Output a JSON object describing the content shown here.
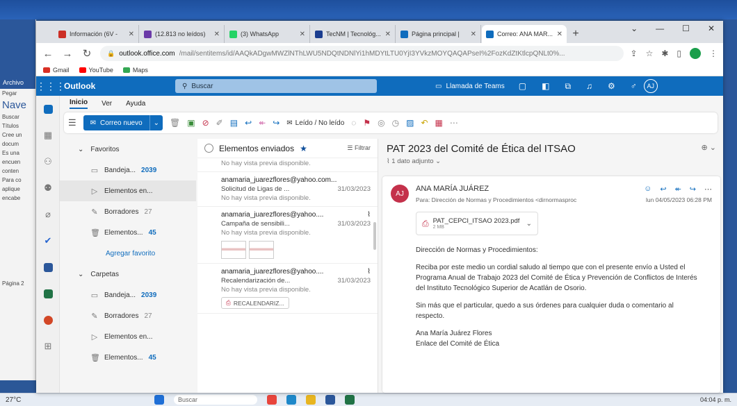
{
  "word": {
    "archivo": "Archivo",
    "pegar": "Pegar",
    "nav": "Nave",
    "buscar": "Buscar",
    "titulos": "Títulos",
    "lines": [
      "Cree un",
      "docum",
      "Es una",
      "encuen",
      "conten",
      "Para co",
      "aplique",
      "encabe"
    ],
    "pagina": "Página 2"
  },
  "taskbar": {
    "temp": "27°C",
    "search": "Buscar",
    "time": "04:04 p. m."
  },
  "browser": {
    "tabs": [
      {
        "title": "Información (6V - ",
        "color": "#cc2f26"
      },
      {
        "title": "(12.813 no leídos) ",
        "color": "#6b3aa8"
      },
      {
        "title": "(3) WhatsApp",
        "color": "#25d366"
      },
      {
        "title": "TecNM | Tecnológ...",
        "color": "#1b3d8f"
      },
      {
        "title": "Página principal | ",
        "color": "#0f6cbd"
      },
      {
        "title": "Correo: ANA MAR...",
        "color": "#0f6cbd"
      }
    ],
    "url_host": "outlook.office.com",
    "url_path": "/mail/sentitems/id/AAQkADgwMWZlNThLWU5NDQtNDNlYi1hMDYtLTU0YjI3YVkzMOYQAQAPseI%2FozKdZtKtlcpQNLt0%...",
    "bookmarks": [
      {
        "label": "Gmail",
        "color": "#d93025"
      },
      {
        "label": "YouTube",
        "color": "#ff0000"
      },
      {
        "label": "Maps",
        "color": "#34a853"
      }
    ]
  },
  "outlook": {
    "brand": "Outlook",
    "search_placeholder": "Buscar",
    "teams_call": "Llamada de Teams",
    "avatar": "AJ",
    "ribbon_tabs": [
      "Inicio",
      "Ver",
      "Ayuda"
    ],
    "new_mail": "Correo nuevo",
    "read_unread": "Leído / No leído",
    "favorites_label": "Favoritos",
    "folders_label": "Carpetas",
    "favorites": [
      {
        "icon": "inbox-icon",
        "label": "Bandeja...",
        "count": "2039",
        "grey": false
      },
      {
        "icon": "sent-icon",
        "label": "Elementos en...",
        "count": "",
        "grey": false
      },
      {
        "icon": "draft-icon",
        "label": "Borradores",
        "count": "27",
        "grey": true
      },
      {
        "icon": "trash-icon",
        "label": "Elementos...",
        "count": "45",
        "grey": false
      }
    ],
    "add_favorite": "Agregar favorito",
    "folders": [
      {
        "icon": "inbox-icon",
        "label": "Bandeja...",
        "count": "2039",
        "grey": false
      },
      {
        "icon": "draft-icon",
        "label": "Borradores",
        "count": "27",
        "grey": true
      },
      {
        "icon": "sent-icon",
        "label": "Elementos en...",
        "count": "",
        "grey": false
      },
      {
        "icon": "trash-icon",
        "label": "Elementos...",
        "count": "45",
        "grey": false
      }
    ],
    "list_title": "Elementos enviados",
    "filter": "Filtrar",
    "messages": [
      {
        "from": "",
        "subject": "",
        "date": "",
        "preview": "No hay vista previa disponible."
      },
      {
        "from": "anamaria_juarezflores@yahoo.com...",
        "subject": "Solicitud de Ligas de ...",
        "date": "31/03/2023",
        "preview": "No hay vista previa disponible."
      },
      {
        "from": "anamaria_juarezflores@yahoo....",
        "subject": "Campaña de sensibili...",
        "date": "31/03/2023",
        "preview": "No hay vista previa disponible."
      },
      {
        "from": "anamaria_juarezflores@yahoo....",
        "subject": "Recalendarización de...",
        "date": "31/03/2023",
        "preview": "No hay vista previa disponible.",
        "chip": "RECALENDARIZ..."
      }
    ],
    "reading": {
      "subject": "PAT 2023 del Comité de Ética del ITSAO",
      "attach_count": "1 dato adjunto",
      "sender_initials": "AJ",
      "sender": "ANA MARÍA JUÁREZ",
      "to": "Para: Dirección de Normas y Procedimientos <dirnormasproc",
      "sent_at": "lun 04/05/2023 06:28 PM",
      "attachment_name": "PAT_CEPCI_ITSAO 2023.pdf",
      "attachment_size": "2 MB",
      "greeting": "Dirección de Normas y Procedimientos:",
      "para1": "Reciba por este medio un cordial saludo al tiempo que con el presente envío a Usted el Programa Anual de Trabajo 2023 del Comité de Ética y Prevención de Conflictos de Interés del Instituto Tecnológico Superior de Acatlán de Osorio.",
      "para2": "Sin más que el particular, quedo a sus órdenes para cualquier duda o comentario al respecto.",
      "sign1": "Ana María Juárez Flores",
      "sign2": "Enlace del Comité de Ética"
    }
  }
}
